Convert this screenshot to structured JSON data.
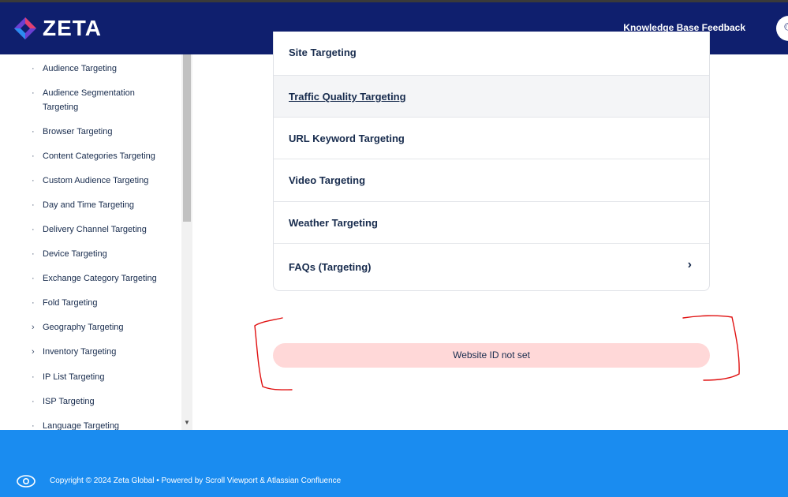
{
  "header": {
    "logo_text": "ZETA",
    "kb_feedback": "Knowledge Base Feedback",
    "search_icon": "search-icon",
    "brand_color": "#0f1f6e"
  },
  "sidebar": {
    "items": [
      {
        "label": "Audience Targeting",
        "marker": "·"
      },
      {
        "label": "Audience Segmentation Targeting",
        "marker": "·"
      },
      {
        "label": "Browser Targeting",
        "marker": "·"
      },
      {
        "label": "Content Categories Targeting",
        "marker": "·"
      },
      {
        "label": "Custom Audience Targeting",
        "marker": "·"
      },
      {
        "label": "Day and Time Targeting",
        "marker": "·"
      },
      {
        "label": "Delivery Channel Targeting",
        "marker": "·"
      },
      {
        "label": "Device Targeting",
        "marker": "·"
      },
      {
        "label": "Exchange Category Targeting",
        "marker": "·"
      },
      {
        "label": "Fold Targeting",
        "marker": "·"
      },
      {
        "label": "Geography Targeting",
        "marker": "›"
      },
      {
        "label": "Inventory Targeting",
        "marker": "›"
      },
      {
        "label": "IP List Targeting",
        "marker": "·"
      },
      {
        "label": "ISP Targeting",
        "marker": "·"
      },
      {
        "label": "Language Targeting",
        "marker": "·"
      }
    ]
  },
  "main": {
    "rows": [
      {
        "label": "Site Targeting"
      },
      {
        "label": "Traffic Quality Targeting"
      },
      {
        "label": "URL Keyword Targeting"
      },
      {
        "label": "Video Targeting"
      },
      {
        "label": "Weather Targeting"
      },
      {
        "label": "FAQs (Targeting)"
      }
    ],
    "chevron": "›",
    "banner_text": "Website ID not set",
    "banner_color": "#ffd8d8"
  },
  "footer": {
    "copyright": "Copyright © 2024 Zeta Global • Powered by Scroll Viewport & Atlassian Confluence",
    "footer_color": "#1a8cf0"
  }
}
